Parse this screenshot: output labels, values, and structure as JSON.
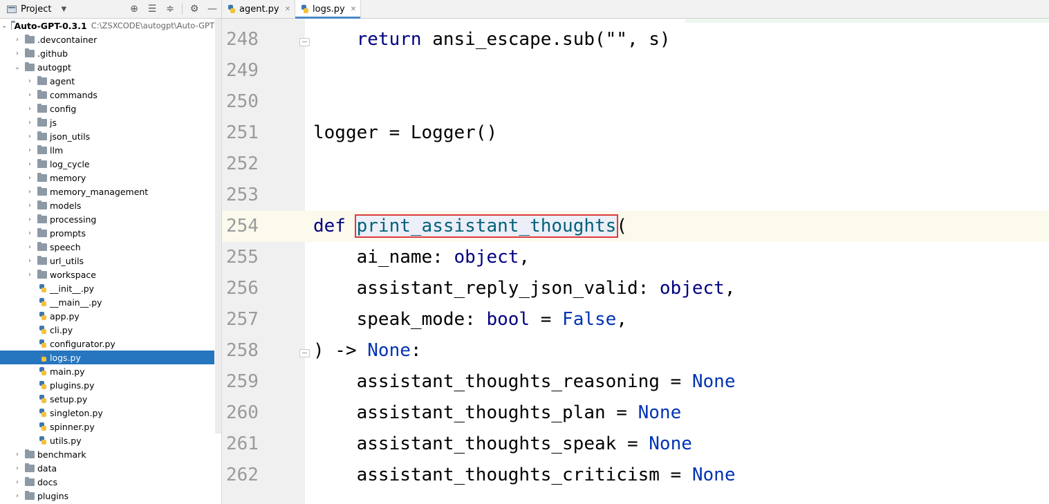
{
  "sidebar": {
    "header": {
      "title": "Project"
    },
    "root": {
      "name": "Auto-GPT-0.3.1",
      "path": "C:\\ZSXCODE\\autogpt\\Auto-GPT"
    },
    "tree": [
      {
        "name": ".devcontainer",
        "type": "folder",
        "depth": 1,
        "expanded": false
      },
      {
        "name": ".github",
        "type": "folder",
        "depth": 1,
        "expanded": false
      },
      {
        "name": "autogpt",
        "type": "folder",
        "depth": 1,
        "expanded": true
      },
      {
        "name": "agent",
        "type": "folder",
        "depth": 2,
        "expanded": false
      },
      {
        "name": "commands",
        "type": "folder",
        "depth": 2,
        "expanded": false
      },
      {
        "name": "config",
        "type": "folder",
        "depth": 2,
        "expanded": false
      },
      {
        "name": "js",
        "type": "folder",
        "depth": 2,
        "expanded": false
      },
      {
        "name": "json_utils",
        "type": "folder",
        "depth": 2,
        "expanded": false
      },
      {
        "name": "llm",
        "type": "folder",
        "depth": 2,
        "expanded": false
      },
      {
        "name": "log_cycle",
        "type": "folder",
        "depth": 2,
        "expanded": false
      },
      {
        "name": "memory",
        "type": "folder",
        "depth": 2,
        "expanded": false
      },
      {
        "name": "memory_management",
        "type": "folder",
        "depth": 2,
        "expanded": false
      },
      {
        "name": "models",
        "type": "folder",
        "depth": 2,
        "expanded": false
      },
      {
        "name": "processing",
        "type": "folder",
        "depth": 2,
        "expanded": false
      },
      {
        "name": "prompts",
        "type": "folder",
        "depth": 2,
        "expanded": false
      },
      {
        "name": "speech",
        "type": "folder",
        "depth": 2,
        "expanded": false
      },
      {
        "name": "url_utils",
        "type": "folder",
        "depth": 2,
        "expanded": false
      },
      {
        "name": "workspace",
        "type": "folder",
        "depth": 2,
        "expanded": false
      },
      {
        "name": "__init__.py",
        "type": "file",
        "depth": 2
      },
      {
        "name": "__main__.py",
        "type": "file",
        "depth": 2
      },
      {
        "name": "app.py",
        "type": "file",
        "depth": 2
      },
      {
        "name": "cli.py",
        "type": "file",
        "depth": 2
      },
      {
        "name": "configurator.py",
        "type": "file",
        "depth": 2
      },
      {
        "name": "logs.py",
        "type": "file",
        "depth": 2,
        "selected": true
      },
      {
        "name": "main.py",
        "type": "file",
        "depth": 2
      },
      {
        "name": "plugins.py",
        "type": "file",
        "depth": 2
      },
      {
        "name": "setup.py",
        "type": "file",
        "depth": 2
      },
      {
        "name": "singleton.py",
        "type": "file",
        "depth": 2
      },
      {
        "name": "spinner.py",
        "type": "file",
        "depth": 2
      },
      {
        "name": "utils.py",
        "type": "file",
        "depth": 2
      },
      {
        "name": "benchmark",
        "type": "folder",
        "depth": 1,
        "expanded": false
      },
      {
        "name": "data",
        "type": "folder",
        "depth": 1,
        "expanded": false
      },
      {
        "name": "docs",
        "type": "folder",
        "depth": 1,
        "expanded": false
      },
      {
        "name": "plugins",
        "type": "folder",
        "depth": 1,
        "expanded": false
      }
    ]
  },
  "tabs": [
    {
      "label": "agent.py",
      "active": false
    },
    {
      "label": "logs.py",
      "active": true
    }
  ],
  "editor": {
    "current_line": 254,
    "highlighted_identifier": "print_assistant_thoughts",
    "lines": [
      {
        "num": "248",
        "tokens": [
          {
            "t": "    "
          },
          {
            "t": "return",
            "c": "kw"
          },
          {
            "t": " ansi_escape.sub(\"\", s)"
          }
        ]
      },
      {
        "num": "249",
        "tokens": []
      },
      {
        "num": "250",
        "tokens": []
      },
      {
        "num": "251",
        "tokens": [
          {
            "t": "logger = Logger()"
          }
        ]
      },
      {
        "num": "252",
        "tokens": []
      },
      {
        "num": "253",
        "tokens": []
      },
      {
        "num": "254",
        "tokens": [
          {
            "t": "def",
            "c": "kw"
          },
          {
            "t": " "
          },
          {
            "t": "print_assistant_thoughts",
            "c": "fn",
            "hl": true
          },
          {
            "t": "("
          }
        ]
      },
      {
        "num": "255",
        "tokens": [
          {
            "t": "    ai_name: "
          },
          {
            "t": "object",
            "c": "kw"
          },
          {
            "t": ","
          }
        ]
      },
      {
        "num": "256",
        "tokens": [
          {
            "t": "    assistant_reply_json_valid: "
          },
          {
            "t": "object",
            "c": "kw"
          },
          {
            "t": ","
          }
        ]
      },
      {
        "num": "257",
        "tokens": [
          {
            "t": "    speak_mode: "
          },
          {
            "t": "bool",
            "c": "kw"
          },
          {
            "t": " = "
          },
          {
            "t": "False",
            "c": "bi"
          },
          {
            "t": ","
          }
        ]
      },
      {
        "num": "258",
        "tokens": [
          {
            "t": ") -> "
          },
          {
            "t": "None",
            "c": "bi"
          },
          {
            "t": ":"
          }
        ]
      },
      {
        "num": "259",
        "tokens": [
          {
            "t": "    assistant_thoughts_reasoning = "
          },
          {
            "t": "None",
            "c": "bi"
          }
        ]
      },
      {
        "num": "260",
        "tokens": [
          {
            "t": "    assistant_thoughts_plan = "
          },
          {
            "t": "None",
            "c": "bi"
          }
        ]
      },
      {
        "num": "261",
        "tokens": [
          {
            "t": "    assistant_thoughts_speak = "
          },
          {
            "t": "None",
            "c": "bi"
          }
        ]
      },
      {
        "num": "262",
        "tokens": [
          {
            "t": "    assistant_thoughts_criticism = "
          },
          {
            "t": "None",
            "c": "bi"
          }
        ]
      }
    ]
  },
  "colors": {
    "selection": "#2675bf",
    "keyword": "#000080",
    "function": "#00627a",
    "builtin": "#0033b3",
    "highlight_border": "#e03a3a"
  }
}
